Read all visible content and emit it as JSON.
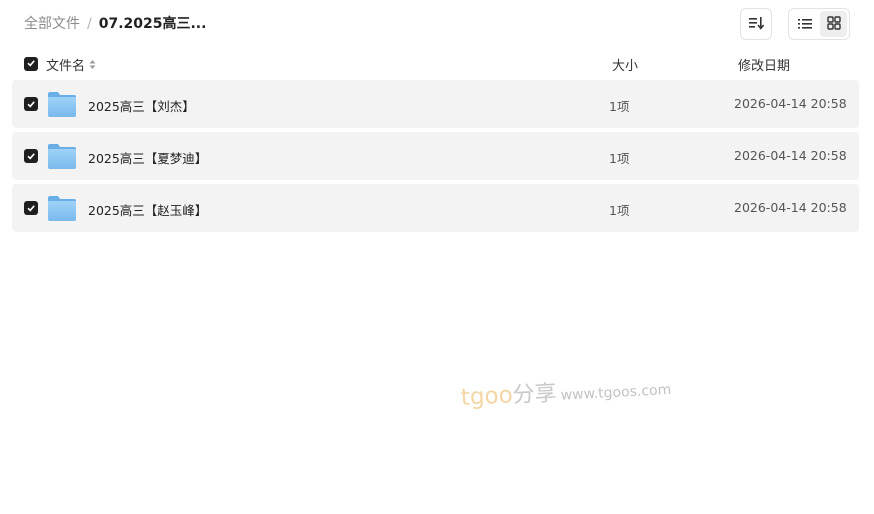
{
  "breadcrumb": {
    "root": "全部文件",
    "separator": "/",
    "current": "07.2025高三..."
  },
  "toolbar": {
    "sort_icon": "sort-icon",
    "list_view_icon": "list-view-icon",
    "grid_view_icon": "grid-view-icon",
    "active_view": "list"
  },
  "columns": {
    "name": "文件名",
    "size": "大小",
    "modified": "修改日期"
  },
  "files": [
    {
      "name": "2025高三【刘杰】",
      "size": "1项",
      "modified": "2026-04-14 20:58",
      "checked": true,
      "icon": "folder-icon"
    },
    {
      "name": "2025高三【夏梦迪】",
      "size": "1项",
      "modified": "2026-04-14 20:58",
      "checked": true,
      "icon": "folder-icon"
    },
    {
      "name": "2025高三【赵玉峰】",
      "size": "1项",
      "modified": "2026-04-14 20:58",
      "checked": true,
      "icon": "folder-icon"
    }
  ],
  "watermark": {
    "brand_a": "tgoo",
    "brand_b": "分享",
    "url": "www.tgoos.com"
  },
  "colors": {
    "row_bg": "#f3f3f3",
    "checkbox": "#1f1f1f",
    "folder": "#8cc8f5"
  }
}
